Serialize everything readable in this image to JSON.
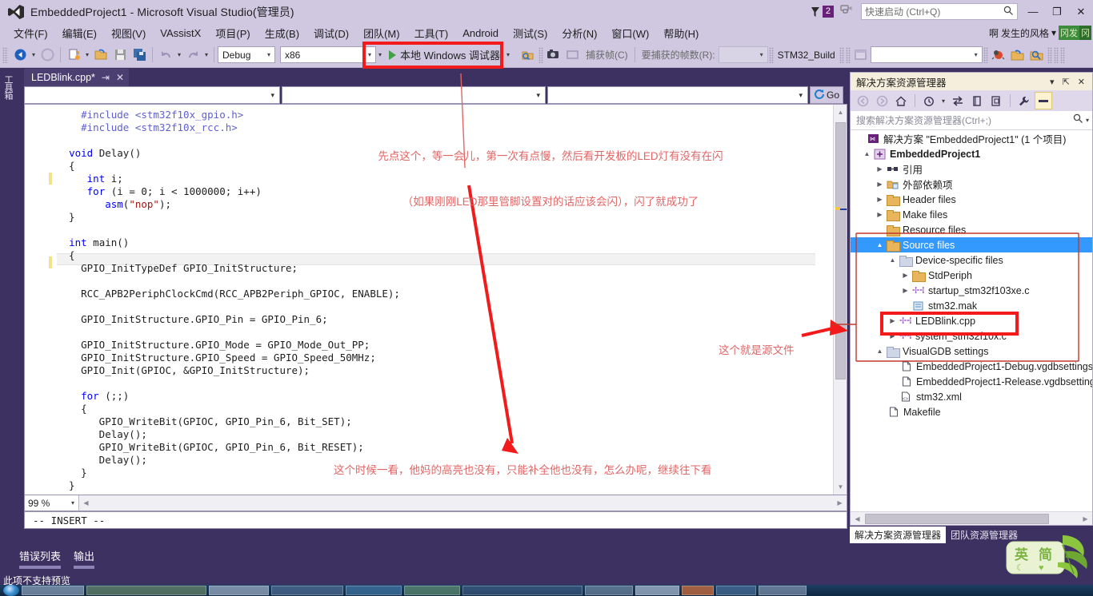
{
  "window": {
    "title": "EmbeddedProject1 - Microsoft Visual Studio(管理员)",
    "logo_icon": "visual-studio-logo-icon",
    "minimize_glyph": "—",
    "maximize_glyph": "❐",
    "close_glyph": "✕"
  },
  "notifications": {
    "count": "2",
    "flag_icon": "notification-flag-icon",
    "feedback_icon": "feedback-icon"
  },
  "quick_launch": {
    "placeholder": "快速启动 (Ctrl+Q)",
    "value": "",
    "icon": "search-icon"
  },
  "menu": {
    "items": [
      {
        "label": "文件(F)"
      },
      {
        "label": "编辑(E)"
      },
      {
        "label": "视图(V)"
      },
      {
        "label": "VAssistX"
      },
      {
        "label": "项目(P)"
      },
      {
        "label": "生成(B)"
      },
      {
        "label": "调试(D)"
      },
      {
        "label": "团队(M)"
      },
      {
        "label": "工具(T)"
      },
      {
        "label": "Android"
      },
      {
        "label": "测试(S)"
      },
      {
        "label": "分析(N)"
      },
      {
        "label": "窗口(W)"
      },
      {
        "label": "帮助(H)"
      }
    ],
    "ime": {
      "char": "啊",
      "label": "发生的风格",
      "caret": "▾",
      "badge1": "冈发",
      "badge2": "冈"
    }
  },
  "toolbar": {
    "back_icon": "navigate-back-icon",
    "forward_icon": "navigate-forward-icon",
    "new_project_icon": "new-project-icon",
    "open_file_icon": "open-file-icon",
    "save_icon": "save-icon",
    "save_all_icon": "save-all-icon",
    "undo_icon": "undo-icon",
    "redo_icon": "redo-icon",
    "configuration": "Debug",
    "platform": "x86",
    "run_label": "本地 Windows 调试器",
    "run_icon": "play-icon",
    "attach_icon": "attach-to-process-icon",
    "camera_icon": "camera-icon",
    "capture_frame_label": "捕获帧(C)",
    "frames_to_capture_label": "要捕获的帧数(R):",
    "frames_value": "",
    "stm32_build": "STM32_Build",
    "window_icon": "window-icon",
    "empty_combo_value": "",
    "bug_icon": "bug-icon",
    "refresh_icon": "refresh-folder-icon",
    "find_icon": "find-in-files-icon"
  },
  "left_strip": {
    "vertical_tab": "工具箱"
  },
  "editor": {
    "tab": {
      "name": "LEDBlink.cpp*",
      "pin_glyph": "⇥",
      "close_glyph": "✕"
    },
    "nav_left": "",
    "nav_mid": "",
    "nav_right": "",
    "go_label": "Go",
    "go_icon": "go-refresh-icon",
    "zoom_level": "99 %",
    "status_line": "-- INSERT --",
    "code": [
      {
        "indent": 4,
        "text": "#include <stm32f10x_gpio.h>",
        "cls": "pp"
      },
      {
        "indent": 4,
        "text": "#include <stm32f10x_rcc.h>",
        "cls": "pp"
      },
      {
        "indent": 0,
        "text": ""
      },
      {
        "indent": 2,
        "text": "void Delay()",
        "cls": "kw1"
      },
      {
        "indent": 2,
        "text": "{"
      },
      {
        "indent": 5,
        "text": "int i;",
        "cls": "kw1"
      },
      {
        "indent": 5,
        "text": "for (i = 0; i < 1000000; i++)",
        "cls": "kw1"
      },
      {
        "indent": 8,
        "text": "asm(\"nop\");",
        "cls": "kw1"
      },
      {
        "indent": 2,
        "text": "}"
      },
      {
        "indent": 0,
        "text": ""
      },
      {
        "indent": 2,
        "text": "int main()",
        "cls": "kw1"
      },
      {
        "indent": 2,
        "text": "{"
      },
      {
        "indent": 3,
        "text": "GPIO_InitTypeDef GPIO_InitStructure;"
      },
      {
        "indent": 0,
        "text": ""
      },
      {
        "indent": 3,
        "text": "RCC_APB2PeriphClockCmd(RCC_APB2Periph_GPIOC, ENABLE);"
      },
      {
        "indent": 0,
        "text": ""
      },
      {
        "indent": 3,
        "text": "GPIO_InitStructure.GPIO_Pin = GPIO_Pin_6;"
      },
      {
        "indent": 0,
        "text": ""
      },
      {
        "indent": 3,
        "text": "GPIO_InitStructure.GPIO_Mode = GPIO_Mode_Out_PP;"
      },
      {
        "indent": 3,
        "text": "GPIO_InitStructure.GPIO_Speed = GPIO_Speed_50MHz;"
      },
      {
        "indent": 3,
        "text": "GPIO_Init(GPIOC, &GPIO_InitStructure);"
      },
      {
        "indent": 0,
        "text": ""
      },
      {
        "indent": 3,
        "text": "for (;;)",
        "cls": "kw1"
      },
      {
        "indent": 3,
        "text": "{"
      },
      {
        "indent": 5,
        "text": "GPIO_WriteBit(GPIOC, GPIO_Pin_6, Bit_SET);"
      },
      {
        "indent": 5,
        "text": "Delay();"
      },
      {
        "indent": 5,
        "text": "GPIO_WriteBit(GPIOC, GPIO_Pin_6, Bit_RESET);"
      },
      {
        "indent": 5,
        "text": "Delay();"
      },
      {
        "indent": 3,
        "text": "}"
      },
      {
        "indent": 2,
        "text": "}"
      }
    ]
  },
  "solution_explorer": {
    "title": "解决方案资源管理器",
    "caret_glyph": "▾",
    "pin_glyph": "⇱",
    "close_glyph": "✕",
    "toolbar_icons": [
      "back-icon",
      "forward-icon",
      "home-icon",
      "pending-changes-icon",
      "sync-with-active-document-icon",
      "refresh-icon",
      "show-all-files-icon",
      "properties-icon",
      "preview-selected-items-icon"
    ],
    "search_placeholder": "搜索解决方案资源管理器(Ctrl+;)",
    "search_icon": "search-icon",
    "tree": [
      {
        "indent": 0,
        "arrow": "",
        "icon": "solution-icon",
        "label": "解决方案 \"EmbeddedProject1\" (1 个项目)",
        "bold": false,
        "selected": false
      },
      {
        "indent": 1,
        "arrow": "▲",
        "icon": "project-icon",
        "label": "EmbeddedProject1",
        "bold": true,
        "selected": false
      },
      {
        "indent": 2,
        "arrow": "▶",
        "icon": "references-icon",
        "label": "引用",
        "bold": false,
        "selected": false
      },
      {
        "indent": 2,
        "arrow": "▶",
        "icon": "external-deps-icon",
        "label": "外部依赖项",
        "bold": false,
        "selected": false
      },
      {
        "indent": 2,
        "arrow": "▶",
        "icon": "folder-icon",
        "label": "Header files",
        "bold": false,
        "selected": false
      },
      {
        "indent": 2,
        "arrow": "▶",
        "icon": "folder-icon",
        "label": "Make files",
        "bold": false,
        "selected": false
      },
      {
        "indent": 2,
        "arrow": "",
        "icon": "folder-icon",
        "label": "Resource files",
        "bold": false,
        "selected": false
      },
      {
        "indent": 2,
        "arrow": "▲",
        "icon": "folder-icon",
        "label": "Source files",
        "bold": false,
        "selected": true
      },
      {
        "indent": 3,
        "arrow": "▲",
        "icon": "folder-icon",
        "label": "Device-specific files",
        "bold": false,
        "selected": false
      },
      {
        "indent": 4,
        "arrow": "▶",
        "icon": "folder-icon",
        "label": "StdPeriph",
        "bold": false,
        "selected": false
      },
      {
        "indent": 4,
        "arrow": "▶",
        "icon": "cpp-file-icon",
        "label": "startup_stm32f103xe.c",
        "bold": false,
        "selected": false
      },
      {
        "indent": 4,
        "arrow": "",
        "icon": "mak-file-icon",
        "label": "stm32.mak",
        "bold": false,
        "selected": false
      },
      {
        "indent": 3,
        "arrow": "▶",
        "icon": "cpp-file-icon",
        "label": "LEDBlink.cpp",
        "bold": false,
        "selected": false
      },
      {
        "indent": 3,
        "arrow": "▶",
        "icon": "cpp-file-icon",
        "label": "system_stm32f10x.c",
        "bold": false,
        "selected": false
      },
      {
        "indent": 2,
        "arrow": "▲",
        "icon": "folder-icon",
        "label": "VisualGDB settings",
        "bold": false,
        "selected": false
      },
      {
        "indent": 3,
        "arrow": "",
        "icon": "file-icon",
        "label": "EmbeddedProject1-Debug.vgdbsettings",
        "bold": false,
        "selected": false
      },
      {
        "indent": 3,
        "arrow": "",
        "icon": "file-icon",
        "label": "EmbeddedProject1-Release.vgdbsettings",
        "bold": false,
        "selected": false
      },
      {
        "indent": 3,
        "arrow": "",
        "icon": "xml-file-icon",
        "label": "stm32.xml",
        "bold": false,
        "selected": false
      },
      {
        "indent": 2,
        "arrow": "",
        "icon": "file-icon",
        "label": "Makefile",
        "bold": false,
        "selected": false
      }
    ],
    "bottom_tabs": [
      {
        "label": "解决方案资源管理器",
        "active": true
      },
      {
        "label": "团队资源管理器",
        "active": false
      }
    ]
  },
  "bottom_panel": {
    "tabs": [
      {
        "label": "错误列表"
      },
      {
        "label": "输出"
      }
    ],
    "preview_note": "此项不支持预览"
  },
  "annotations": {
    "run_hint_line1": "先点这个，等一会儿，第一次有点慢，然后看开发板的LED灯有没有在闪",
    "run_hint_line2": "（如果刚刚LED那里管脚设置对的话应该会闪），闪了就成功了",
    "bottom_hint": "这个时候一看，他妈的高亮也没有，只能补全他也没有，怎么办呢，继续往下看",
    "source_file_hint": "这个就是源文件",
    "accent_red": "#f21a1a",
    "text_red": "#e06666"
  },
  "watermark": {
    "char1": "英",
    "char2": "简"
  }
}
